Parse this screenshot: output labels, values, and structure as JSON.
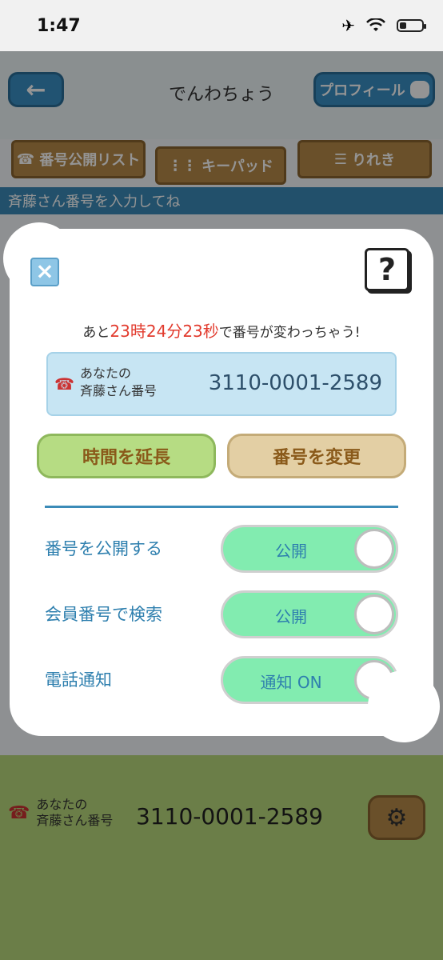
{
  "status_bar": {
    "time": "1:47",
    "airplane_icon": "airplane-icon",
    "wifi_icon": "wifi-icon",
    "battery_icon": "battery-icon"
  },
  "app": {
    "title": "でんわちょう",
    "back_label": "←",
    "profile_label": "プロフィール",
    "tabs": [
      {
        "label": "番号公開リスト",
        "icon": "phone-icon"
      },
      {
        "label": "キーパッド",
        "icon": "keypad-icon"
      },
      {
        "label": "りれき",
        "icon": "list-icon"
      }
    ],
    "hint": "斉藤さん番号を入力してね",
    "footer": {
      "label_line1": "あなたの",
      "label_line2": "斉藤さん番号",
      "number": "3110-0001-2589"
    }
  },
  "modal": {
    "close_label": "×",
    "help_label": "?",
    "countdown": {
      "prefix": "あと",
      "hours": "23",
      "hours_unit": "時",
      "minutes": "24",
      "minutes_unit": "分",
      "seconds": "23",
      "seconds_unit": "秒",
      "suffix": "で番号が変わっちゃう!"
    },
    "number_box": {
      "label_line1": "あなたの",
      "label_line2": "斉藤さん番号",
      "number": "3110-0001-2589"
    },
    "extend_button": "時間を延長",
    "change_button": "番号を変更",
    "settings": [
      {
        "label": "番号を公開する",
        "state": "公開"
      },
      {
        "label": "会員番号で検索",
        "state": "公開"
      },
      {
        "label": "電話通知",
        "state": "通知 ON"
      }
    ]
  },
  "colors": {
    "accent": "#3b8bb8",
    "red": "#e23b2e",
    "toggle_on": "#82ecb0"
  }
}
